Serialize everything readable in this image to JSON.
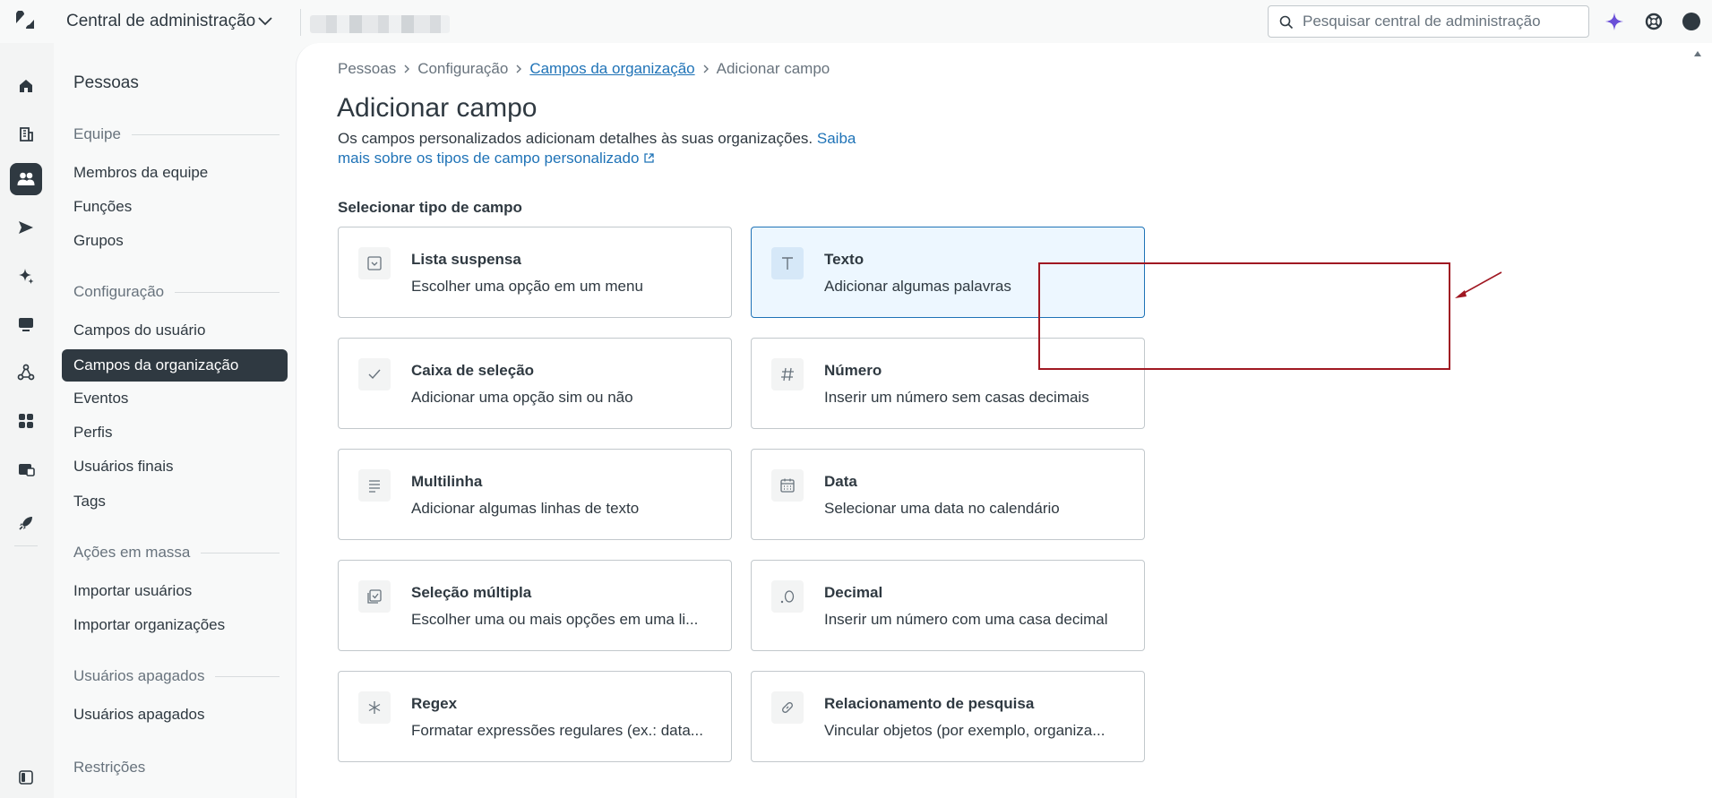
{
  "app": {
    "title": "Central de administração",
    "search_placeholder": "Pesquisar central de administração",
    "accent": "#1f73b7",
    "dark": "#2f3941",
    "highlight_color": "#a01822"
  },
  "sidebar": {
    "title": "Pessoas",
    "sections": [
      {
        "label": "Equipe",
        "items": [
          "Membros da equipe",
          "Funções",
          "Grupos"
        ]
      },
      {
        "label": "Configuração",
        "items": [
          "Campos do usuário",
          "Campos da organização",
          "Eventos",
          "Perfis",
          "Usuários finais",
          "Tags"
        ]
      },
      {
        "label": "Ações em massa",
        "items": [
          "Importar usuários",
          "Importar organizações"
        ]
      },
      {
        "label": "Usuários apagados",
        "items": [
          "Usuários apagados"
        ]
      },
      {
        "label": "Restrições",
        "items": []
      }
    ],
    "active_item": "Campos da organização"
  },
  "breadcrumb": {
    "items": [
      "Pessoas",
      "Configuração",
      "Campos da organização",
      "Adicionar campo"
    ]
  },
  "page": {
    "title": "Adicionar campo",
    "description": "Os campos personalizados adicionam detalhes às suas organizações.",
    "learn_more_link": "Saiba mais sobre os tipos de campo personalizado",
    "section_label": "Selecionar tipo de campo"
  },
  "field_types": [
    {
      "title": "Lista suspensa",
      "subtitle": "Escolher uma opção em um menu",
      "icon": "dropdown-icon",
      "selected": false
    },
    {
      "title": "Texto",
      "subtitle": "Adicionar algumas palavras",
      "icon": "text-icon",
      "selected": true
    },
    {
      "title": "Caixa de seleção",
      "subtitle": "Adicionar uma opção sim ou não",
      "icon": "checkmark-icon",
      "selected": false
    },
    {
      "title": "Número",
      "subtitle": "Inserir um número sem casas decimais",
      "icon": "hash-icon",
      "selected": false
    },
    {
      "title": "Multilinha",
      "subtitle": "Adicionar algumas linhas de texto",
      "icon": "lines-icon",
      "selected": false
    },
    {
      "title": "Data",
      "subtitle": "Selecionar uma data no calendário",
      "icon": "calendar-icon",
      "selected": false
    },
    {
      "title": "Seleção múltipla",
      "subtitle": "Escolher uma ou mais opções em uma li...",
      "icon": "multiselect-icon",
      "selected": false
    },
    {
      "title": "Decimal",
      "subtitle": "Inserir um número com uma casa decimal",
      "icon": "decimal-icon",
      "selected": false
    },
    {
      "title": "Regex",
      "subtitle": "Formatar expressões regulares (ex.: data...",
      "icon": "asterisk-icon",
      "selected": false
    },
    {
      "title": "Relacionamento de pesquisa",
      "subtitle": "Vincular objetos (por exemplo, organiza...",
      "icon": "link-icon",
      "selected": false
    }
  ]
}
